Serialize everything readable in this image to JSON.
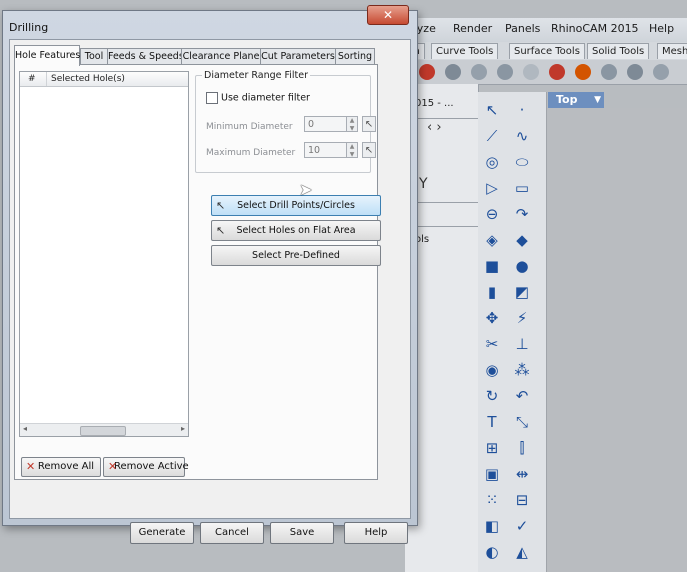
{
  "background_app": {
    "menu": [
      "alyze",
      "Render",
      "Panels",
      "RhinoCAM 2015",
      "Help"
    ],
    "toolbar_tabs": [
      "m",
      "Curve Tools",
      "Surface Tools",
      "Solid Tools",
      "Mesh"
    ],
    "viewport_title_partial": "015 - ...",
    "pane_label": "ols",
    "viewport_tab": "Top"
  },
  "dialog": {
    "title": "Drilling",
    "close_label": "✕",
    "tabs": [
      "Hole Features",
      "Tool",
      "Feeds & Speeds",
      "Clearance Plane",
      "Cut Parameters",
      "Sorting"
    ],
    "active_tab": "Hole Features",
    "holes_table": {
      "columns": [
        "#",
        "Selected Hole(s)"
      ],
      "rows": []
    },
    "remove_all_label": "Remove All",
    "remove_active_label": "Remove Active",
    "diameter_filter": {
      "title": "Diameter Range Filter",
      "use_label": "Use diameter filter",
      "use_checked": false,
      "min_label": "Minimum Diameter",
      "min_value": "0",
      "max_label": "Maximum Diameter",
      "max_value": "10"
    },
    "actions": {
      "select_drill_points": "Select Drill Points/Circles",
      "select_holes_flat": "Select Holes on Flat Area",
      "select_predefined": "Select Pre-Defined"
    },
    "footer": {
      "generate": "Generate",
      "cancel": "Cancel",
      "save": "Save",
      "help": "Help"
    }
  }
}
